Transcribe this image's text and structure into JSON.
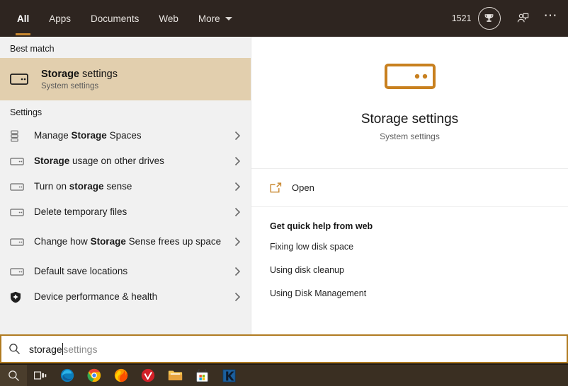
{
  "header": {
    "tabs": [
      {
        "label": "All",
        "active": true
      },
      {
        "label": "Apps",
        "active": false
      },
      {
        "label": "Documents",
        "active": false
      },
      {
        "label": "Web",
        "active": false
      },
      {
        "label": "More",
        "active": false,
        "has_caret": true
      }
    ],
    "rewards_count": "1521",
    "rewards_icon": "trophy-icon",
    "feedback_icon": "feedback-icon",
    "more_menu_icon": "ellipsis-icon",
    "background_color": "#2e2520",
    "accent_color": "#c8872f"
  },
  "left_pane": {
    "best_match": {
      "section_label": "Best match",
      "icon": "drive-icon",
      "title_bold": "Storage",
      "title_rest": " settings",
      "subtitle": "System settings",
      "highlight_color": "#e2cfae"
    },
    "settings": {
      "section_label": "Settings",
      "items": [
        {
          "icon": "storage-spaces-icon",
          "pre": "Manage ",
          "bold": "Storage",
          "post": " Spaces",
          "chevron": "chevron-right-icon"
        },
        {
          "icon": "drive-icon",
          "pre": "",
          "bold": "Storage",
          "post": " usage on other drives",
          "chevron": "chevron-right-icon"
        },
        {
          "icon": "drive-icon",
          "pre": "Turn on ",
          "bold": "storage",
          "post": " sense",
          "chevron": "chevron-right-icon"
        },
        {
          "icon": "drive-icon",
          "pre": "Delete temporary files",
          "bold": "",
          "post": "",
          "chevron": "chevron-right-icon"
        },
        {
          "icon": "drive-icon",
          "pre": "Change how ",
          "bold": "Storage",
          "post": " Sense frees up space",
          "chevron": "chevron-right-icon",
          "tall": true
        },
        {
          "icon": "drive-icon",
          "pre": "Default save locations",
          "bold": "",
          "post": "",
          "chevron": "chevron-right-icon"
        },
        {
          "icon": "shield-icon",
          "pre": "Device performance & health",
          "bold": "",
          "post": "",
          "chevron": "chevron-right-icon"
        }
      ]
    }
  },
  "right_pane": {
    "hero": {
      "icon": "drive-icon-large",
      "icon_color": "#c8801f",
      "title": "Storage settings",
      "subtitle": "System settings"
    },
    "open_action": {
      "icon": "open-external-icon",
      "label": "Open"
    },
    "quick_help": {
      "title": "Get quick help from web",
      "links": [
        "Fixing low disk space",
        "Using disk cleanup",
        "Using Disk Management"
      ]
    }
  },
  "search_bar": {
    "icon": "search-icon",
    "typed_value": "storage",
    "suggestion_suffix": "settings",
    "border_color": "#b07b21"
  },
  "taskbar": {
    "background_color": "#3a2f22",
    "items": [
      {
        "name": "search-icon",
        "label": "Search",
        "active": true
      },
      {
        "name": "task-view-icon",
        "label": "Task View",
        "active": false
      },
      {
        "name": "edge-icon",
        "label": "Microsoft Edge",
        "active": false
      },
      {
        "name": "chrome-icon",
        "label": "Google Chrome",
        "active": false
      },
      {
        "name": "firefox-icon",
        "label": "Mozilla Firefox",
        "active": false
      },
      {
        "name": "checkmark-app-icon",
        "label": "V App",
        "active": false
      },
      {
        "name": "file-explorer-icon",
        "label": "File Explorer",
        "active": false
      },
      {
        "name": "microsoft-store-icon",
        "label": "Microsoft Store",
        "active": false
      },
      {
        "name": "k-app-icon",
        "label": "K App",
        "active": false
      }
    ]
  }
}
